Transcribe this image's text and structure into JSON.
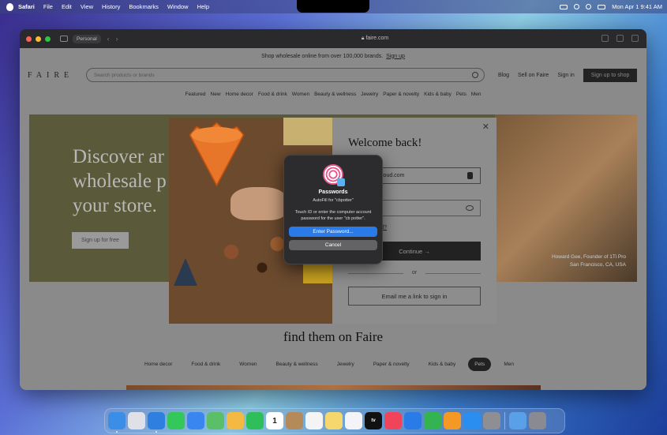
{
  "menubar": {
    "app": "Safari",
    "items": [
      "File",
      "Edit",
      "View",
      "History",
      "Bookmarks",
      "Window",
      "Help"
    ],
    "datetime": "Mon Apr 1  9:41 AM"
  },
  "browser": {
    "profile": "Personal",
    "url": "faire.com"
  },
  "faire": {
    "promo": "Shop wholesale online from over 100,000 brands.",
    "promo_link": "Sign up",
    "logo": "FAIRE",
    "search_placeholder": "Search products or brands",
    "header_links": [
      "Blog",
      "Sell on Faire",
      "Sign in"
    ],
    "signup": "Sign up to shop",
    "categories": [
      "Featured",
      "New",
      "Home decor",
      "Food & drink",
      "Women",
      "Beauty & wellness",
      "Jewelry",
      "Paper & novelty",
      "Kids & baby",
      "Pets",
      "Men"
    ],
    "hero_lines": [
      "Discover ar",
      "wholesale p",
      "your store."
    ],
    "hero_button": "Sign up for free",
    "hero_caption_1": "Howard Gee, Founder of 1Ti Pro",
    "hero_caption_2": "San Francisco, CA, USA",
    "section_title": "find them on Faire",
    "pills": [
      "Home decor",
      "Food & drink",
      "Women",
      "Beauty & wellness",
      "Jewelry",
      "Paper & novelty",
      "Kids & baby",
      "Pets",
      "Men"
    ],
    "active_pill": "Pets"
  },
  "login": {
    "close": "✕",
    "title": "Welcome back!",
    "email_value": "loud.com",
    "forgot": "ord?",
    "continue": "Continue →",
    "or": "or",
    "email_link": "Email me a link to sign in"
  },
  "passwords": {
    "title": "Passwords",
    "subtitle": "AutoFill for \"cbpotter\"",
    "body": "Touch ID or enter the computer account password for the user \"cb potter\".",
    "primary": "Enter Password...",
    "cancel": "Cancel"
  },
  "dock": {
    "apps": [
      {
        "name": "finder-icon",
        "color": "#3a8ee6",
        "run": true
      },
      {
        "name": "launchpad-icon",
        "color": "#e0e0e8"
      },
      {
        "name": "safari-icon",
        "color": "#2f7fe0",
        "run": true
      },
      {
        "name": "messages-icon",
        "color": "#34c759"
      },
      {
        "name": "mail-icon",
        "color": "#3a86f0"
      },
      {
        "name": "maps-icon",
        "color": "#5bbf6a"
      },
      {
        "name": "photos-icon",
        "color": "#f4b942"
      },
      {
        "name": "facetime-icon",
        "color": "#2fbf5a"
      },
      {
        "name": "calendar-icon",
        "color": "#ffffff"
      },
      {
        "name": "contacts-icon",
        "color": "#b58a5a"
      },
      {
        "name": "reminders-icon",
        "color": "#f4f4f4"
      },
      {
        "name": "notes-icon",
        "color": "#f5d76e"
      },
      {
        "name": "freeform-icon",
        "color": "#f4f4f8"
      },
      {
        "name": "tv-icon",
        "color": "#111111",
        "label": "tv"
      },
      {
        "name": "music-icon",
        "color": "#f0445a"
      },
      {
        "name": "keynote-icon",
        "color": "#2a7ae8"
      },
      {
        "name": "numbers-icon",
        "color": "#34b450"
      },
      {
        "name": "pages-icon",
        "color": "#f49a24"
      },
      {
        "name": "app-store-icon",
        "color": "#2a8ef0"
      },
      {
        "name": "system-settings-icon",
        "color": "#8e8e93"
      }
    ],
    "calendar_day": "1"
  }
}
